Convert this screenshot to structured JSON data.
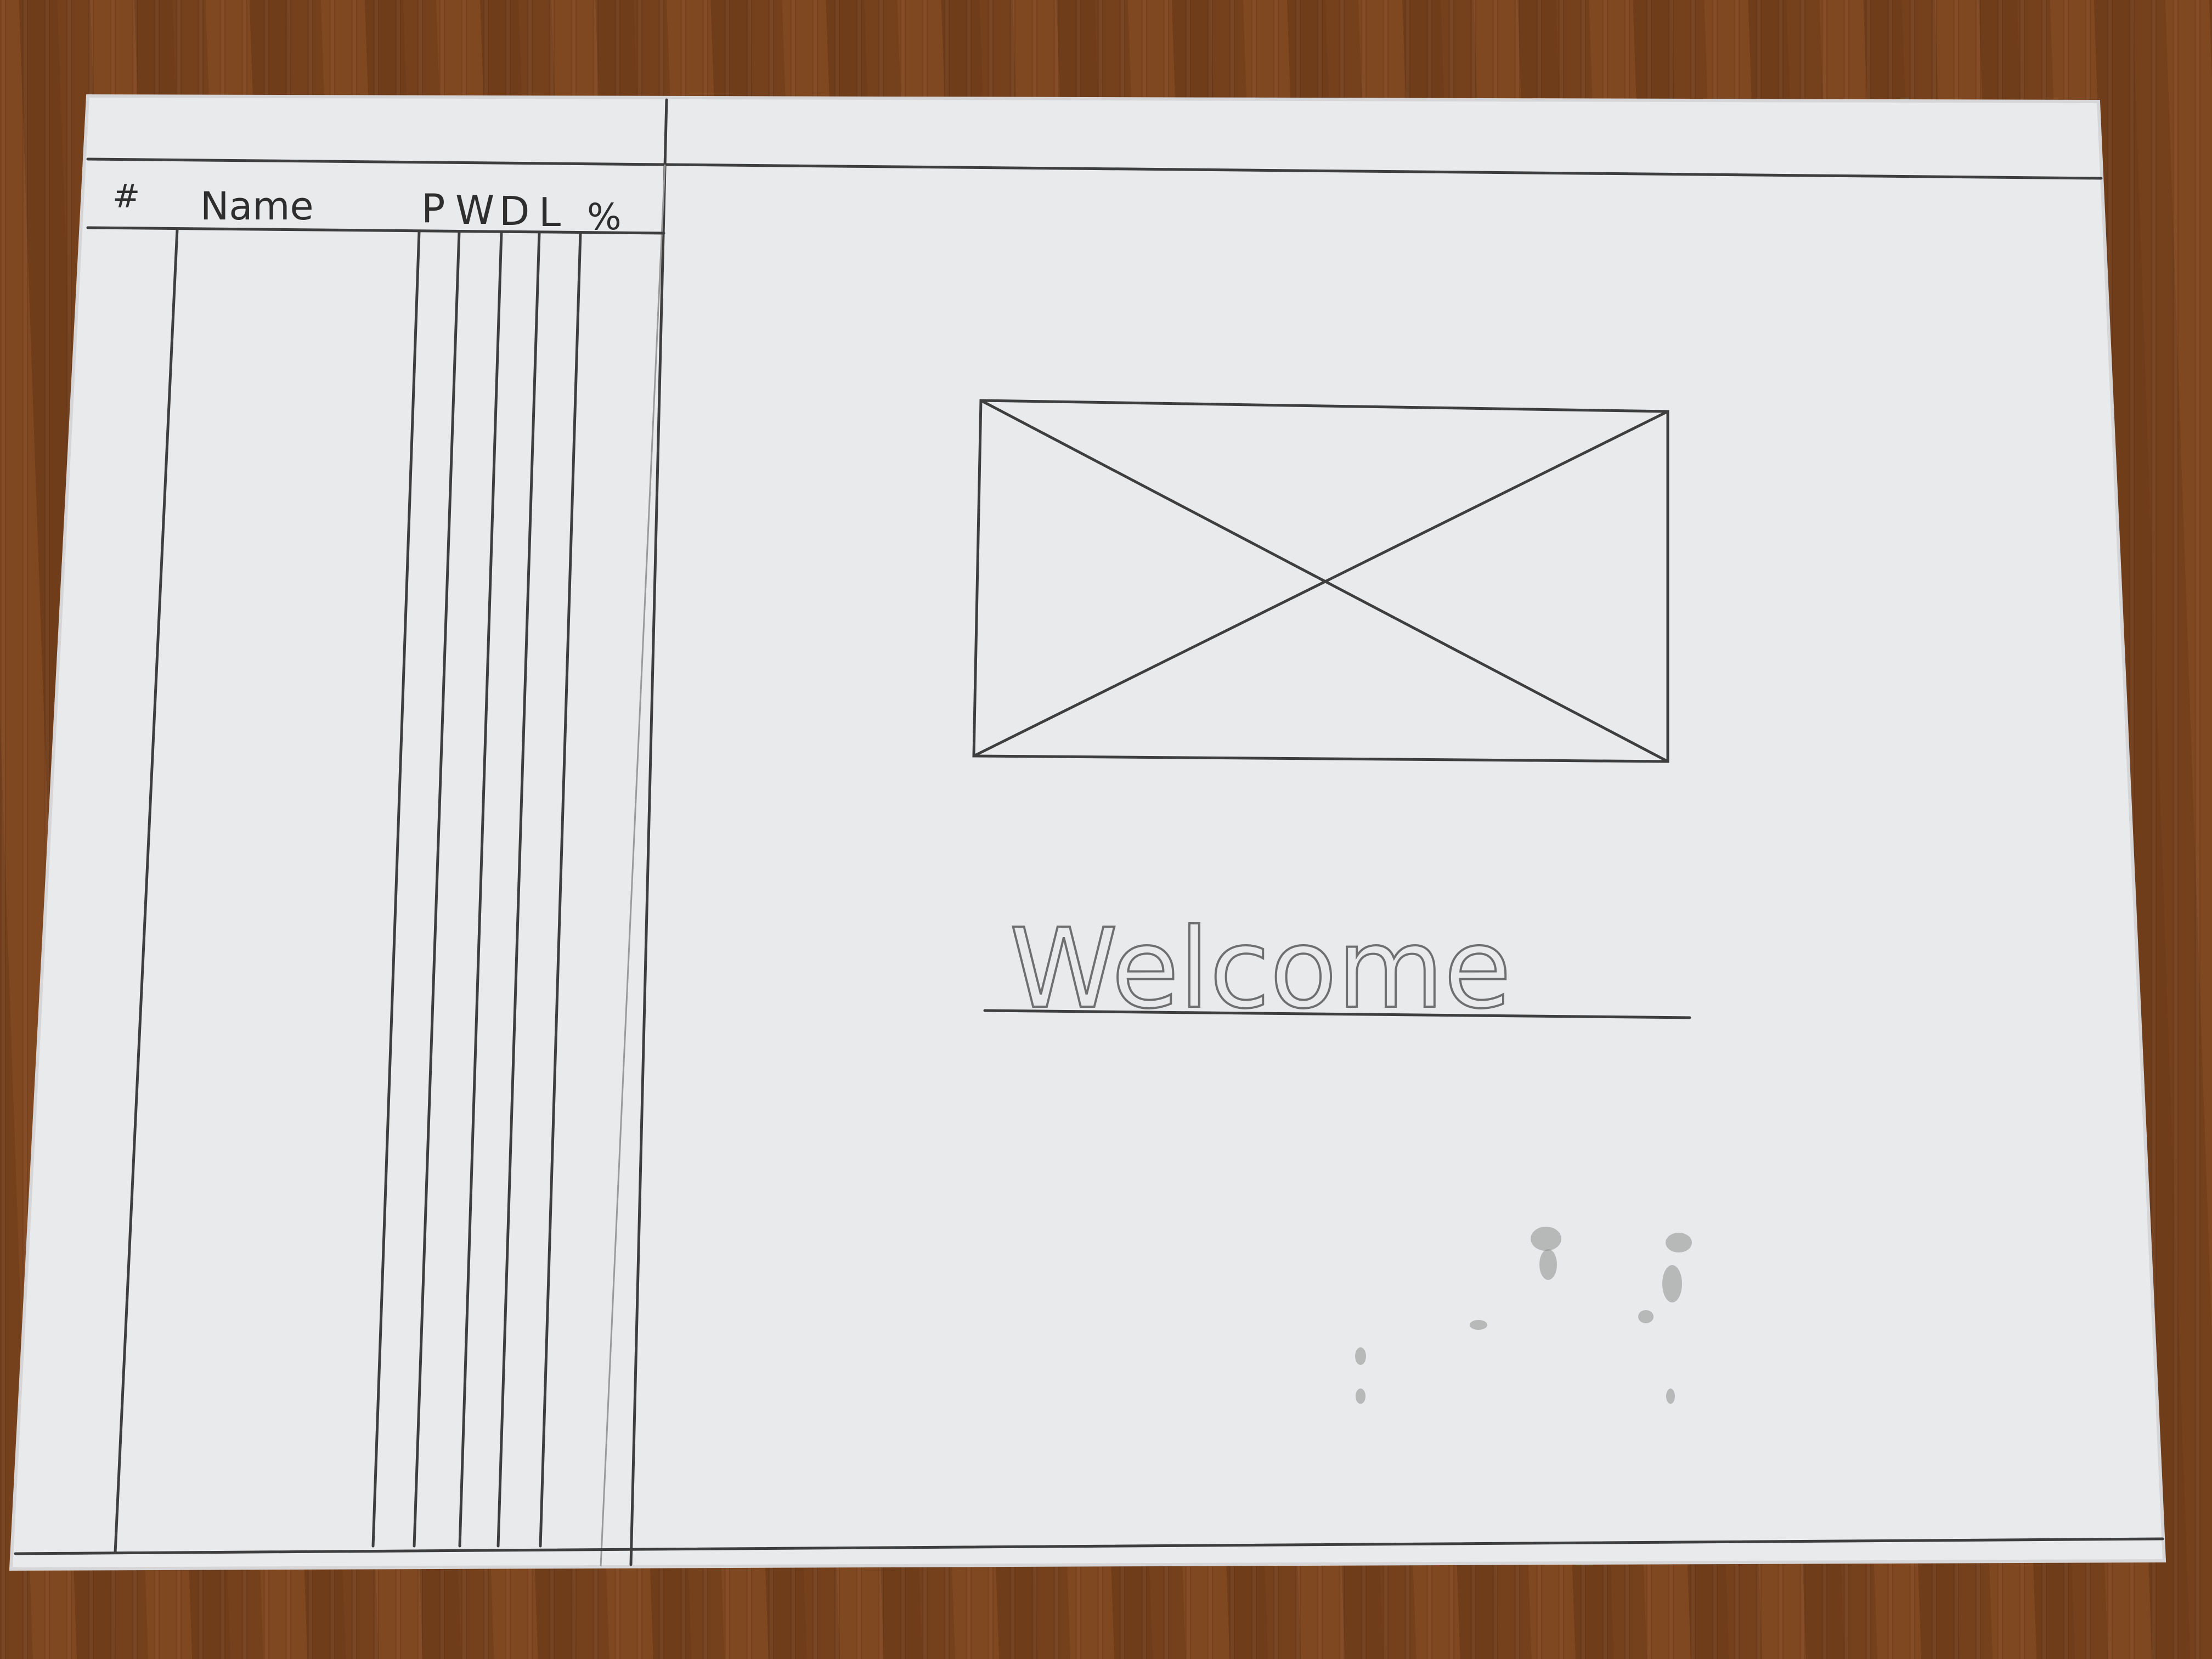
{
  "table": {
    "headers": {
      "rank": "#",
      "name": "Name",
      "played": "P",
      "won": "W",
      "drawn": "D",
      "lost": "L",
      "percent": "%"
    }
  },
  "main": {
    "welcome": "Welcome"
  }
}
